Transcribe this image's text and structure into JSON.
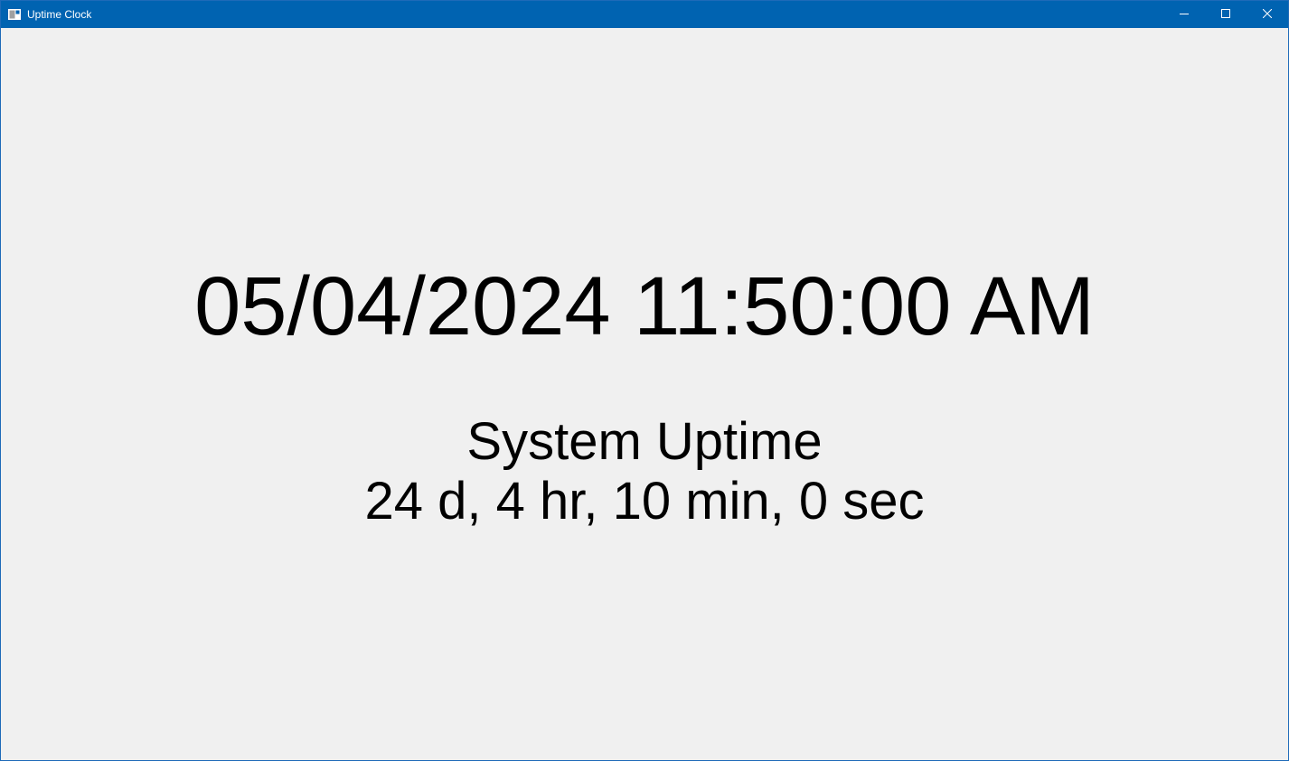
{
  "window": {
    "title": "Uptime Clock",
    "icon": "app-window-icon",
    "titlebar_color": "#0063b1",
    "controls": {
      "minimize_icon": "minimize-icon",
      "maximize_icon": "maximize-icon",
      "close_icon": "close-icon"
    }
  },
  "clock": {
    "datetime": "05/04/2024 11:50:00 AM"
  },
  "uptime": {
    "heading": "System Uptime",
    "value": "24 d, 4 hr, 10 min, 0 sec"
  }
}
